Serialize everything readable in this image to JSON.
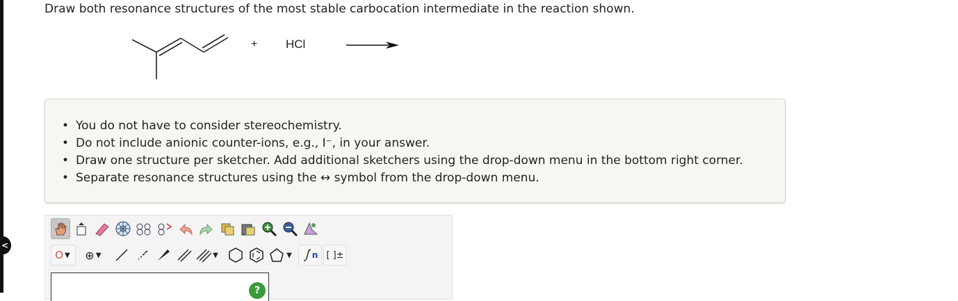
{
  "question": {
    "text": "Draw both resonance structures of the most stable carbocation intermediate in the reaction shown."
  },
  "reaction": {
    "plus": "+",
    "reagent": "HCl"
  },
  "instructions": [
    "You do not have to consider stereochemistry.",
    "Do not include anionic counter-ions, e.g., I⁻, in your answer.",
    "Draw one structure per sketcher. Add additional sketchers using the drop-down menu in the bottom right corner.",
    "Separate resonance structures using the ↔ symbol from the drop-down menu."
  ],
  "sketcher": {
    "toolbar_row1": [
      "hand-icon",
      "erase-all-icon",
      "eraser-icon",
      "ring-template-icon",
      "atom-map-icon",
      "undo-icon",
      "redo-icon",
      "copy-icon",
      "paste-icon",
      "zoom-in-icon",
      "zoom-out-icon",
      "clean-icon"
    ],
    "element_value": "O",
    "charge_value": "⊕",
    "bracket_label": "[ ]±",
    "sgroup_label": "n",
    "help_label": "?",
    "colors": {
      "accent_red": "#d9534f",
      "help_green": "#3a9a3a"
    }
  }
}
